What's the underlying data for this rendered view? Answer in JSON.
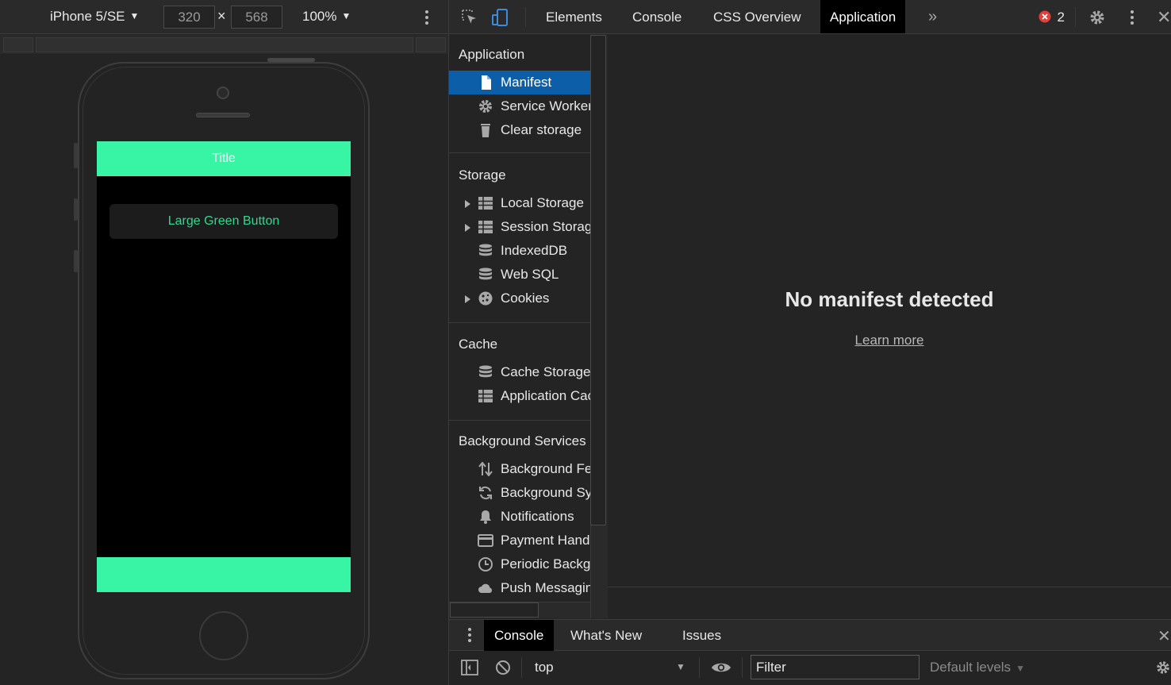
{
  "device_toolbar": {
    "device": "iPhone 5/SE",
    "width": "320",
    "height": "568",
    "dimension_separator": "×",
    "zoom": "100%"
  },
  "emulated_app": {
    "title": "Title",
    "button_label": "Large Green Button",
    "accent_color": "#38f5a6"
  },
  "devtools": {
    "tabs": [
      "Elements",
      "Console",
      "CSS Overview",
      "Application"
    ],
    "active_tab": "Application",
    "more_tabs_icon": "chevrons-right-icon",
    "error_count": "2",
    "error_color": "#e0403a"
  },
  "sidebar": {
    "sections": [
      {
        "title": "Application",
        "items": [
          {
            "label": "Manifest",
            "icon": "document-icon",
            "selected": true
          },
          {
            "label": "Service Workers",
            "icon": "gear-icon"
          },
          {
            "label": "Clear storage",
            "icon": "trash-icon"
          }
        ]
      },
      {
        "title": "Storage",
        "items": [
          {
            "label": "Local Storage",
            "icon": "table-icon",
            "expandable": true
          },
          {
            "label": "Session Storage",
            "icon": "table-icon",
            "expandable": true
          },
          {
            "label": "IndexedDB",
            "icon": "database-icon"
          },
          {
            "label": "Web SQL",
            "icon": "database-icon"
          },
          {
            "label": "Cookies",
            "icon": "cookie-icon",
            "expandable": true
          }
        ]
      },
      {
        "title": "Cache",
        "items": [
          {
            "label": "Cache Storage",
            "icon": "database-icon"
          },
          {
            "label": "Application Cache",
            "icon": "table-icon"
          }
        ]
      },
      {
        "title": "Background Services",
        "items": [
          {
            "label": "Background Fetch",
            "icon": "arrows-updown-icon"
          },
          {
            "label": "Background Sync",
            "icon": "sync-icon"
          },
          {
            "label": "Notifications",
            "icon": "bell-icon"
          },
          {
            "label": "Payment Handler",
            "icon": "card-icon"
          },
          {
            "label": "Periodic Background Sync",
            "icon": "clock-icon"
          },
          {
            "label": "Push Messaging",
            "icon": "cloud-icon"
          }
        ]
      }
    ]
  },
  "main": {
    "empty_title": "No manifest detected",
    "learn_more": "Learn more"
  },
  "drawer": {
    "tabs": [
      "Console",
      "What's New",
      "Issues"
    ],
    "active_tab": "Console",
    "context": "top",
    "filter_placeholder": "Filter",
    "levels": "Default levels"
  }
}
